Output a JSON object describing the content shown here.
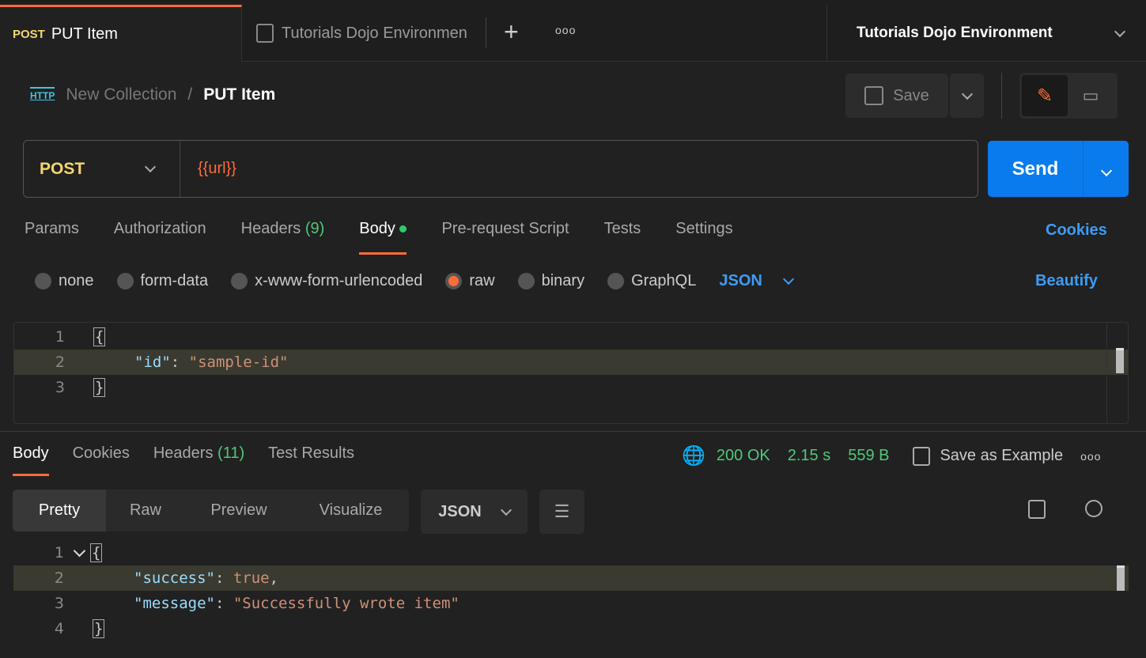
{
  "tabs": {
    "active": {
      "method": "POST",
      "name": "PUT Item"
    },
    "second": "Tutorials Dojo Environmen",
    "environment": "Tutorials Dojo Environment"
  },
  "breadcrumb": {
    "icon": "HTTP",
    "collection": "New Collection",
    "separator": "/",
    "request": "PUT Item"
  },
  "toolbar": {
    "save": "Save"
  },
  "request": {
    "method": "POST",
    "url": "{{url}}",
    "send": "Send"
  },
  "req_tabs": [
    {
      "label": "Params"
    },
    {
      "label": "Authorization"
    },
    {
      "label": "Headers",
      "count": "(9)"
    },
    {
      "label": "Body"
    },
    {
      "label": "Pre-request Script"
    },
    {
      "label": "Tests"
    },
    {
      "label": "Settings"
    }
  ],
  "cookies": "Cookies",
  "body_types": [
    "none",
    "form-data",
    "x-www-form-urlencoded",
    "raw",
    "binary",
    "GraphQL"
  ],
  "body_format": "JSON",
  "beautify": "Beautify",
  "request_body": {
    "lines": [
      "1",
      "2",
      "3"
    ],
    "open": "{",
    "key": "\"id\"",
    "colon": ": ",
    "value": "\"sample-id\"",
    "close": "}"
  },
  "response": {
    "tabs": [
      "Body",
      "Cookies",
      "Headers",
      "Test Results"
    ],
    "headers_count": "(11)",
    "status": "200 OK",
    "time": "2.15 s",
    "size": "559 B",
    "save_example": "Save as Example",
    "views": [
      "Pretty",
      "Raw",
      "Preview",
      "Visualize"
    ],
    "format": "JSON",
    "body": {
      "lines": [
        "1",
        "2",
        "3",
        "4"
      ],
      "open": "{",
      "k1": "\"success\"",
      "v1": "true",
      "comma": ",",
      "k2": "\"message\"",
      "v2": "\"Successfully wrote item\"",
      "colon": ": ",
      "close": "}"
    }
  },
  "colors": {
    "accent": "#ff6c37",
    "send": "#097bed",
    "post": "#f5d76e",
    "link": "#3d9cf5",
    "success": "#50c878"
  }
}
